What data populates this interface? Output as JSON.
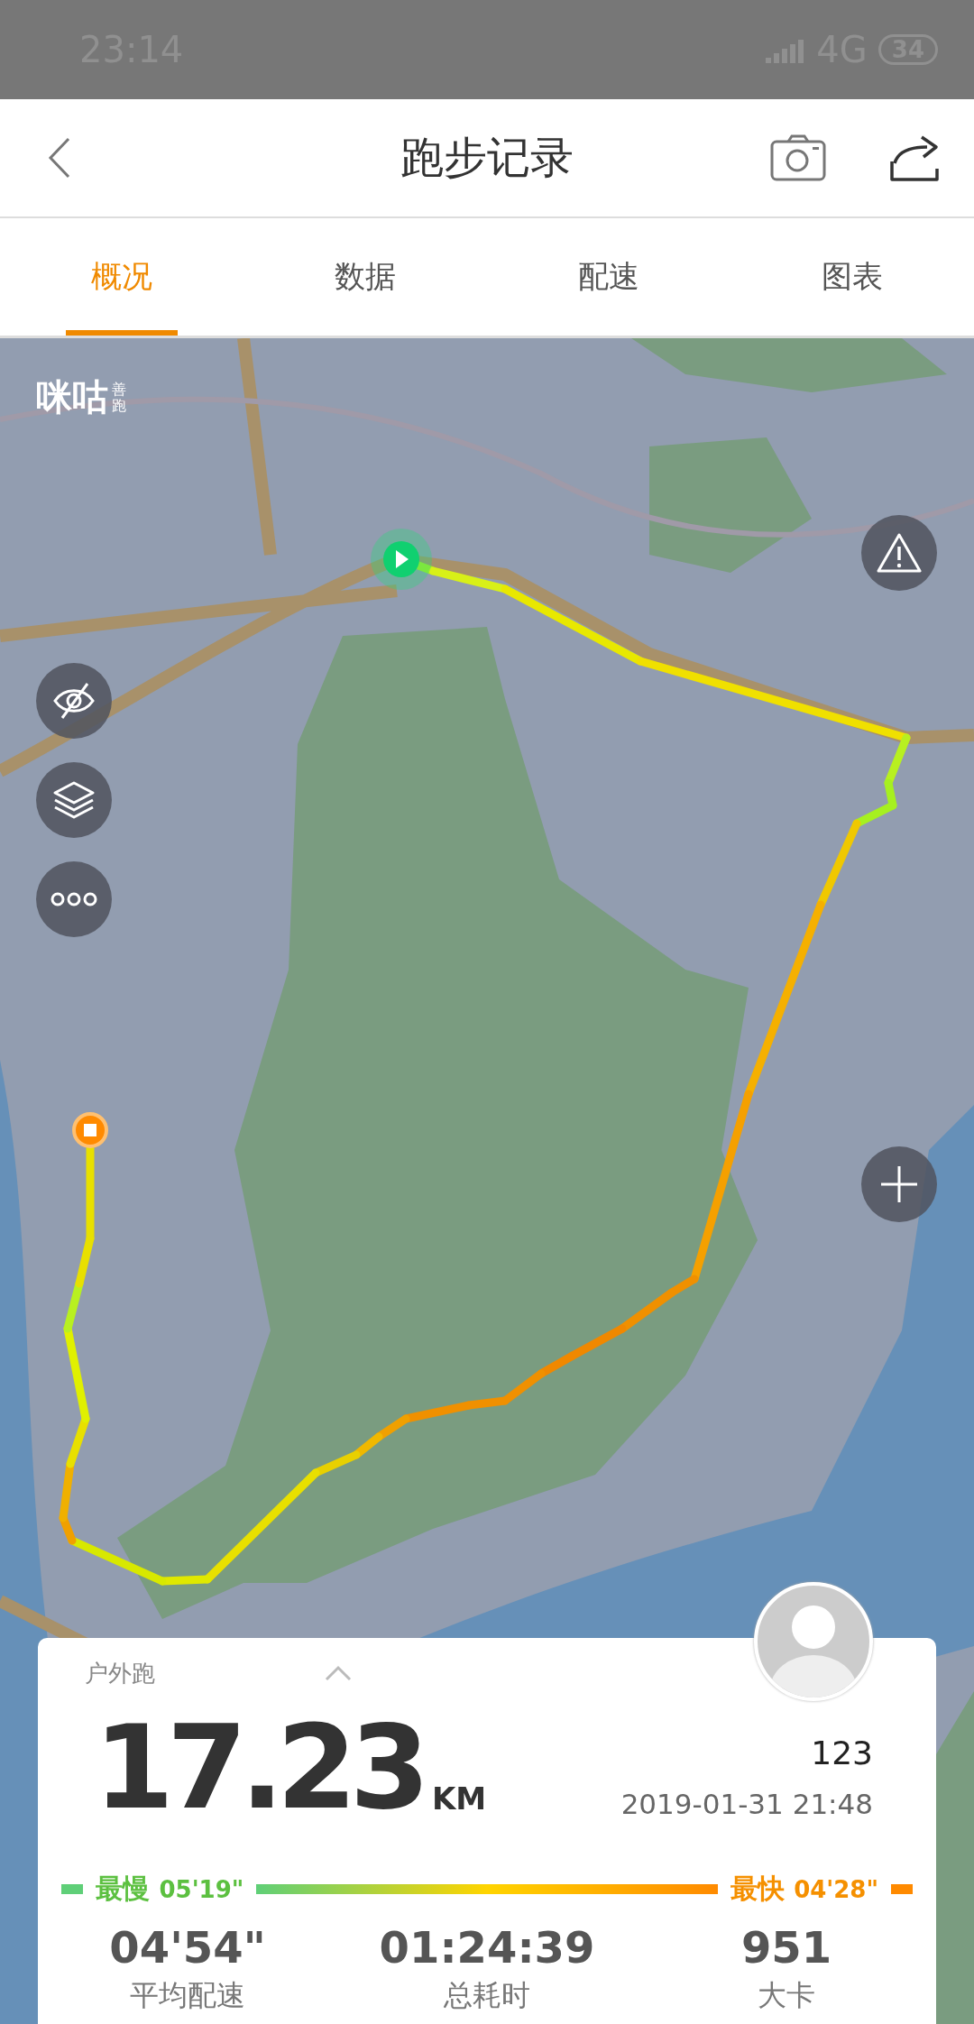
{
  "status_bar": {
    "time": "23:14",
    "network": "4G",
    "battery": "34"
  },
  "header": {
    "title": "跑步记录"
  },
  "tabs": [
    {
      "label": "概况",
      "selected": true
    },
    {
      "label": "数据",
      "selected": false
    },
    {
      "label": "配速",
      "selected": false
    },
    {
      "label": "图表",
      "selected": false
    }
  ],
  "map": {
    "logo": "咪咕",
    "logo_sub": "善跑"
  },
  "summary": {
    "activity_type": "户外跑",
    "distance": "17.23",
    "unit": "KM",
    "user_id": "123",
    "datetime": "2019-01-31 21:48",
    "pace_range": {
      "slow_label": "最慢",
      "slow_value": "05'19\"",
      "fast_label": "最快",
      "fast_value": "04'28\""
    },
    "stats": [
      {
        "value": "04'54\"",
        "label": "平均配速"
      },
      {
        "value": "01:24:39",
        "label": "总耗时"
      },
      {
        "value": "951",
        "label": "大卡"
      }
    ]
  }
}
